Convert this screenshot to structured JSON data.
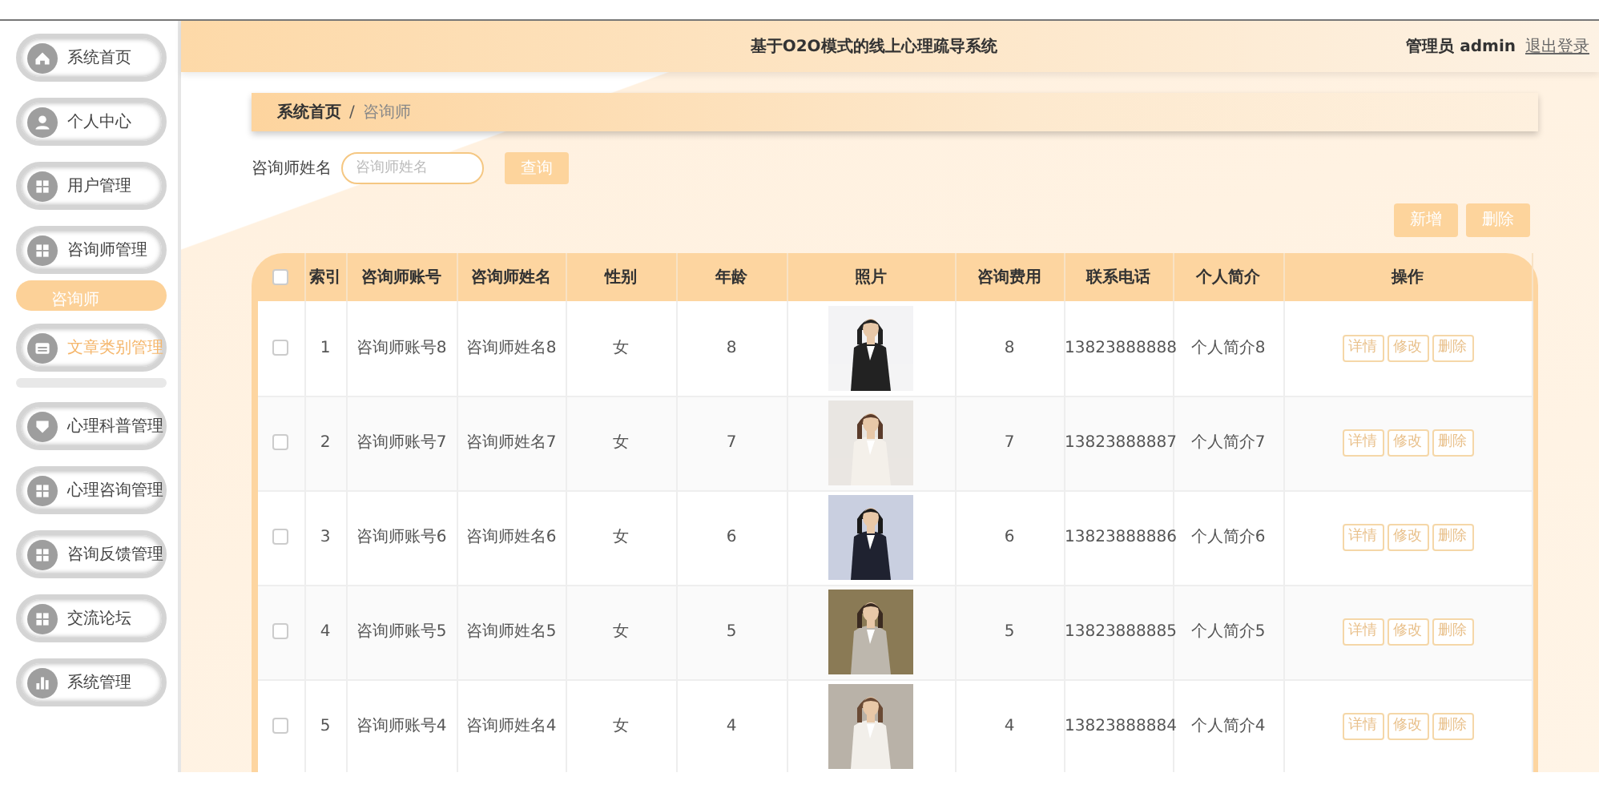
{
  "header": {
    "title": "基于O2O模式的线上心理疏导系统",
    "user": "管理员 admin",
    "logout": "退出登录"
  },
  "sidebar": {
    "items": [
      {
        "label": "系统首页",
        "highlighted": false
      },
      {
        "label": "个人中心",
        "highlighted": false
      },
      {
        "label": "用户管理",
        "highlighted": false
      },
      {
        "label": "咨询师管理",
        "highlighted": false,
        "children": [
          {
            "label": "咨询师",
            "selected": true
          }
        ]
      },
      {
        "label": "文章类别管理",
        "highlighted": true
      },
      {
        "label": "心理科普管理",
        "highlighted": false
      },
      {
        "label": "心理咨询管理",
        "highlighted": false
      },
      {
        "label": "咨询反馈管理",
        "highlighted": false
      },
      {
        "label": "交流论坛",
        "highlighted": false
      },
      {
        "label": "系统管理",
        "highlighted": false
      }
    ]
  },
  "breadcrumb": [
    "系统首页",
    "/",
    "咨询师"
  ],
  "search": {
    "label": "咨询师姓名",
    "placeholder": "咨询师姓名",
    "button": "查询"
  },
  "actions": [
    "新增",
    "删除"
  ],
  "table": {
    "all_checked": false,
    "columns": [
      "索引",
      "咨询师账号",
      "咨询师姓名",
      "性别",
      "年龄",
      "照片",
      "咨询费用",
      "联系电话",
      "个人简介",
      "操作"
    ],
    "rows": [
      {
        "checked": false,
        "cells": [
          "1",
          "咨询师账号8",
          "咨询师姓名8",
          "女",
          "8",
          {
            "kind": "picture"
          },
          "8",
          "13823888888",
          "个人简介8"
        ],
        "buttons": [
          "详情",
          "修改",
          "删除"
        ]
      },
      {
        "checked": false,
        "cells": [
          "2",
          "咨询师账号7",
          "咨询师姓名7",
          "女",
          "7",
          {
            "kind": "picture"
          },
          "7",
          "13823888887",
          "个人简介7"
        ],
        "buttons": [
          "详情",
          "修改",
          "删除"
        ]
      },
      {
        "checked": false,
        "cells": [
          "3",
          "咨询师账号6",
          "咨询师姓名6",
          "女",
          "6",
          {
            "kind": "picture"
          },
          "6",
          "13823888886",
          "个人简介6"
        ],
        "buttons": [
          "详情",
          "修改",
          "删除"
        ]
      },
      {
        "checked": false,
        "cells": [
          "4",
          "咨询师账号5",
          "咨询师姓名5",
          "女",
          "5",
          {
            "kind": "picture"
          },
          "5",
          "13823888885",
          "个人简介5"
        ],
        "buttons": [
          "详情",
          "修改",
          "删除"
        ]
      },
      {
        "checked": false,
        "cells": [
          "5",
          "咨询师账号4",
          "咨询师姓名4",
          "女",
          "4",
          {
            "kind": "picture"
          },
          "4",
          "13823888884",
          "个人简介4"
        ],
        "buttons": [
          "详情",
          "修改",
          "删除"
        ]
      }
    ]
  }
}
